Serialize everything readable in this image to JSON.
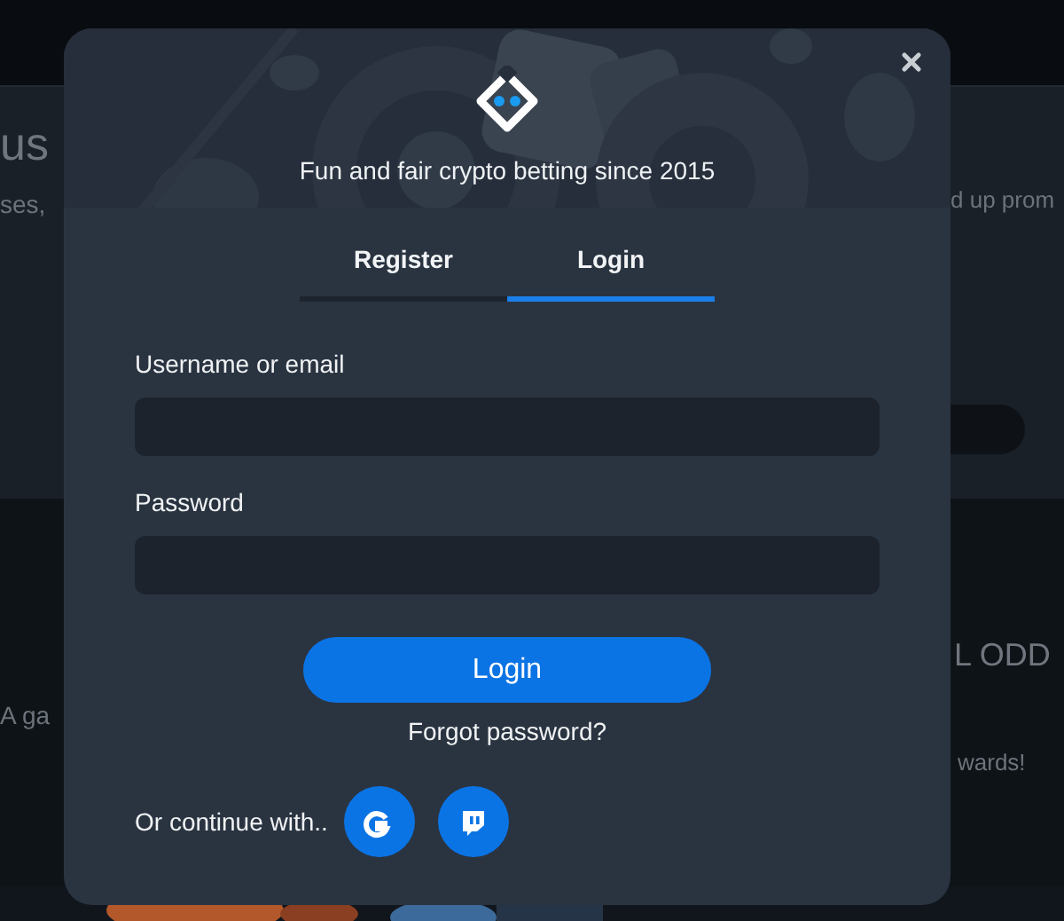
{
  "background_page": {
    "left_texts": [
      {
        "kind": "heading",
        "text": "us"
      },
      {
        "kind": "text",
        "text": "ses,"
      },
      {
        "kind": "text",
        "text": "A ga"
      }
    ],
    "right_texts": [
      {
        "kind": "text",
        "text": "d up prom"
      },
      {
        "kind": "heading",
        "text": "L ODD"
      },
      {
        "kind": "text",
        "text": "wards!"
      }
    ]
  },
  "modal": {
    "header": {
      "kind": "picture",
      "tagline": "Fun and fair crypto betting since 2015"
    },
    "tabs": [
      {
        "label": "Register",
        "selected": false
      },
      {
        "label": "Login",
        "selected": true
      }
    ],
    "fields": [
      {
        "label": "Username or email"
      },
      {
        "label": "Password"
      }
    ],
    "submit_button": "Login",
    "forgot_link": "Forgot password?",
    "social": {
      "label": "Or continue with..",
      "buttons": [
        {
          "kind": "google"
        },
        {
          "kind": "twitch"
        }
      ]
    }
  }
}
